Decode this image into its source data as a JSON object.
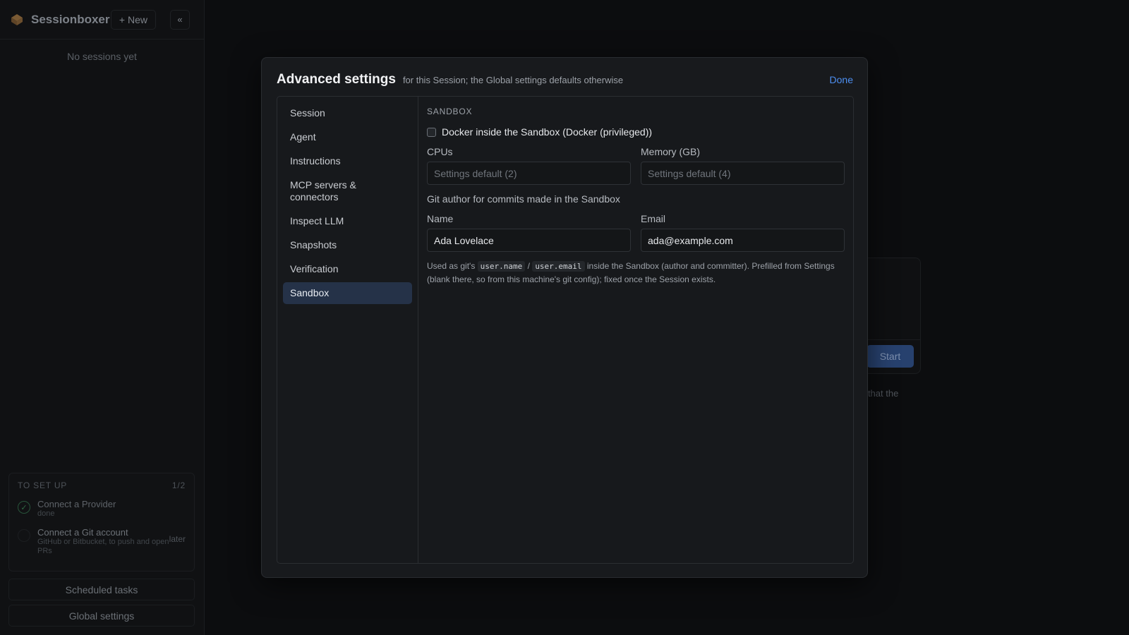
{
  "sidebar": {
    "app_title": "Sessionboxer",
    "new_label": "+ New",
    "collapse_label": "«",
    "empty_text": "No sessions yet",
    "setup": {
      "heading": "TO SET UP",
      "progress": "1/2",
      "items": [
        {
          "title": "Connect a Provider",
          "subtitle": "done",
          "status": "done"
        },
        {
          "title": "Connect a Git account",
          "subtitle": "GitHub or Bitbucket, to push and open PRs",
          "action": "later"
        }
      ]
    },
    "scheduled_tasks_label": "Scheduled tasks",
    "global_settings_label": "Global settings"
  },
  "background": {
    "start_label": "Start",
    "partial_text": ") that the"
  },
  "modal": {
    "title": "Advanced settings",
    "subtitle": "for this Session; the Global settings defaults otherwise",
    "done_label": "Done",
    "nav": [
      {
        "label": "Session"
      },
      {
        "label": "Agent"
      },
      {
        "label": "Instructions"
      },
      {
        "label": "MCP servers & connectors"
      },
      {
        "label": "Inspect LLM"
      },
      {
        "label": "Snapshots"
      },
      {
        "label": "Verification"
      },
      {
        "label": "Sandbox",
        "active": true
      }
    ],
    "sandbox": {
      "section_label": "SANDBOX",
      "docker_label": "Docker inside the Sandbox (Docker (privileged))",
      "docker_checked": false,
      "cpus_label": "CPUs",
      "cpus_placeholder": "Settings default (2)",
      "memory_label": "Memory (GB)",
      "memory_placeholder": "Settings default (4)",
      "git_author_label": "Git author for commits made in the Sandbox",
      "name_label": "Name",
      "name_value": "Ada Lovelace",
      "email_label": "Email",
      "email_value": "ada@example.com",
      "help_prefix": "Used as git's",
      "help_code_1": "user.name",
      "help_sep": "/",
      "help_code_2": "user.email",
      "help_suffix": "inside the Sandbox (author and committer). Prefilled from Settings (blank there, so from this machine's git config); fixed once the Session exists."
    }
  },
  "colors": {
    "accent": "#4d8ef0",
    "active_nav_bg": "#253248",
    "modal_bg": "#181a1d",
    "page_bg": "#0c0d0f"
  }
}
